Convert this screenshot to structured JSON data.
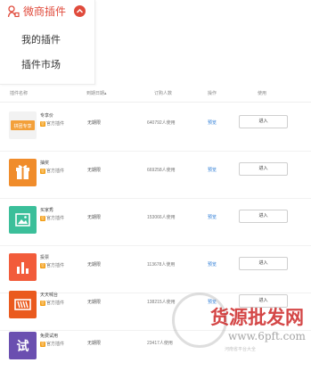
{
  "panel": {
    "title": "微商插件",
    "items": [
      "我的插件",
      "插件市场"
    ],
    "colors": {
      "accent": "#e04b3c"
    }
  },
  "table": {
    "headers": [
      "插件名称",
      "到期日期▴",
      "订购人数",
      "操作",
      "使用"
    ],
    "official_label": "官方插件",
    "official_badge": "官",
    "rows": [
      {
        "name": "专享价",
        "icon_text": "拼团专享",
        "icon_color": "#f2f2f2",
        "expire": "无期限",
        "users": "640792人使用",
        "preview": "预览",
        "enter": "进入"
      },
      {
        "name": "抽奖",
        "icon_text": "",
        "icon_color": "#f08c2b",
        "expire": "无期限",
        "users": "669258人使用",
        "preview": "预览",
        "enter": "进入"
      },
      {
        "name": "买家秀",
        "icon_text": "",
        "icon_color": "#3bbf9a",
        "expire": "无期限",
        "users": "153066人使用",
        "preview": "预览",
        "enter": "进入"
      },
      {
        "name": "投票",
        "icon_text": "",
        "icon_color": "#f25c3b",
        "expire": "无期限",
        "users": "113678人使用",
        "preview": "预览",
        "enter": "进入"
      },
      {
        "name": "天天喊台",
        "icon_text": "",
        "icon_color": "#ea5a1e",
        "expire": "无期限",
        "users": "138215人使用",
        "preview": "预览",
        "enter": "进入"
      },
      {
        "name": "免费试用",
        "icon_text": "试",
        "icon_color": "#6a4fb0",
        "expire": "无期限",
        "users": "23417人使用",
        "preview": "",
        "enter": ""
      }
    ]
  },
  "watermark": {
    "text": "货源批发网",
    "url": "www.6pft.com",
    "sub": "河南省平台大全"
  }
}
